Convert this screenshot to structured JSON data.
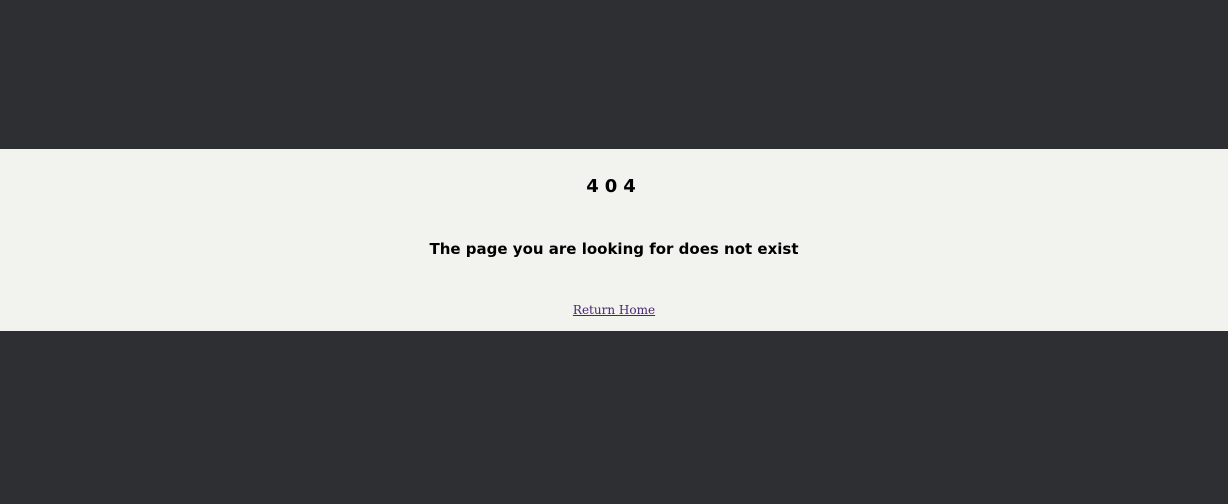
{
  "error": {
    "code": "404",
    "message": "The page you are looking for does not exist",
    "link_label": "Return Home"
  },
  "colors": {
    "background": "#2e2f33",
    "band": "#f2f2ee",
    "text": "#000000",
    "link": "#4a2574"
  }
}
